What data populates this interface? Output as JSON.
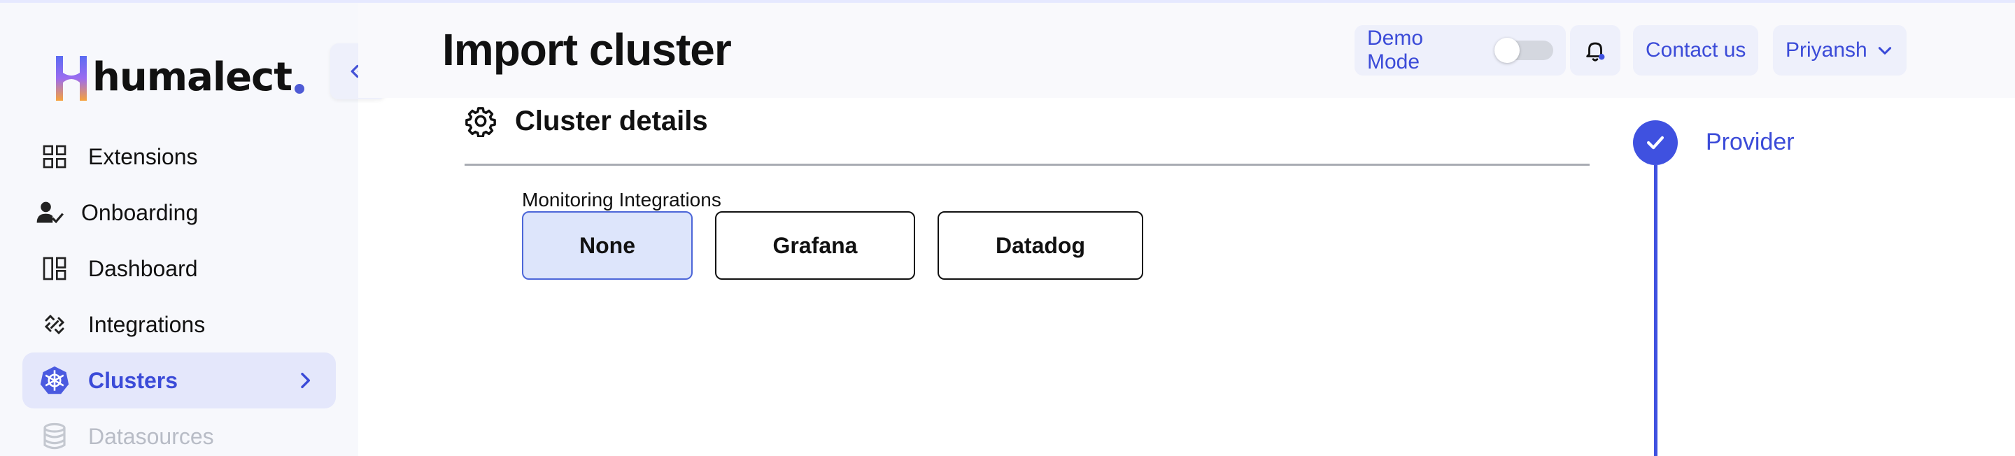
{
  "brand": {
    "name": "humalect"
  },
  "sidebar": {
    "items": [
      {
        "label": "Extensions",
        "icon": "grid-icon",
        "state": "default"
      },
      {
        "label": "Onboarding",
        "icon": "user-check-icon",
        "state": "default"
      },
      {
        "label": "Dashboard",
        "icon": "layout-icon",
        "state": "default"
      },
      {
        "label": "Integrations",
        "icon": "link-icon",
        "state": "default"
      },
      {
        "label": "Clusters",
        "icon": "kubernetes-icon",
        "state": "active"
      },
      {
        "label": "Datasources",
        "icon": "database-icon",
        "state": "disabled"
      }
    ]
  },
  "header": {
    "title": "Import cluster",
    "demo_mode_label": "Demo Mode",
    "demo_mode_on": false,
    "contact_label": "Contact us",
    "user_name": "Priyansh"
  },
  "section": {
    "title": "Cluster details",
    "field_label": "Monitoring Integrations",
    "options": [
      "None",
      "Grafana",
      "Datadog"
    ],
    "selected": "None"
  },
  "stepper": {
    "steps": [
      {
        "label": "Provider",
        "status": "completed"
      }
    ]
  },
  "colors": {
    "accent": "#3f51e0",
    "active_bg": "#e4e7fb",
    "selected_option_bg": "#dde5fb"
  }
}
